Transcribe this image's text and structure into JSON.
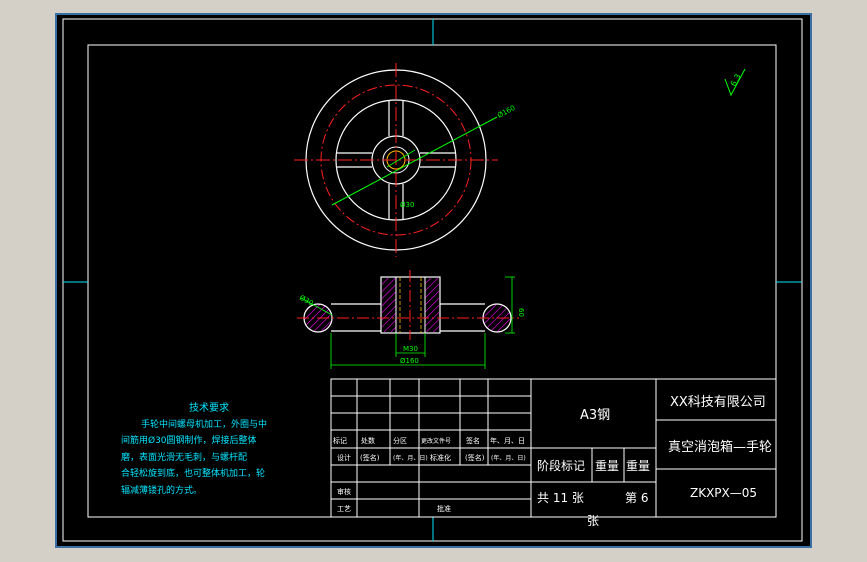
{
  "colors": {
    "app_background": "#d4d0c8",
    "viewport_border": "#3a6ea5",
    "canvas": "#000000",
    "frame": "#ffffff",
    "part_outline": "#ffffff",
    "center_line": "#ff2020",
    "hatch": "#ff00ff",
    "dimension": "#00ff00",
    "text_tech": "#00e5ff",
    "title_text": "#ffffff",
    "sheet_marker": "#00e5ff",
    "roughness_symbol": "#00ff00"
  },
  "roughness_symbol": {
    "value": "6.3"
  },
  "top_view": {
    "dimensions": {
      "outer_diameter": "Ø160",
      "hub_diameter": "Ø30"
    }
  },
  "section_view": {
    "dimensions": {
      "rim_diameter": "Ø30",
      "height": "60",
      "hub_width": "M30",
      "overall": "Ø160"
    }
  },
  "tech_requirements": {
    "title": "技术要求",
    "lines": [
      "手轮中间螺母机加工，外圈与中",
      "间筋用Ø30圆钢制作，焊接后整体",
      "磨，表面光滑无毛刺，与螺杆配",
      "合轻松旋到底，也可整体机加工，轮",
      "辐减薄镂孔的方式。"
    ]
  },
  "title_block": {
    "material": "A3钢",
    "company": "XX科技有限公司",
    "part_name": "真空消泡箱—手轮",
    "drawing_no": "ZKXPX—05",
    "stage_mark": "阶段标记",
    "weight": "重量",
    "scale": "重量",
    "total_sheets": "共 11 张",
    "sheet_no": "第 6",
    "sheet_unit": "张",
    "labels": {
      "mark": "标记",
      "count": "处数",
      "zone": "分区",
      "change_doc": "更改文件号",
      "signature": "签名",
      "date_ymd": "年、月、日",
      "design": "设计",
      "sign1": "(签名)",
      "date1": "(年、月、日)",
      "standardize": "标准化",
      "sign2": "(签名)",
      "date2": "(年、月、日)",
      "review": "审核",
      "process": "工艺",
      "approve": "批准"
    }
  }
}
